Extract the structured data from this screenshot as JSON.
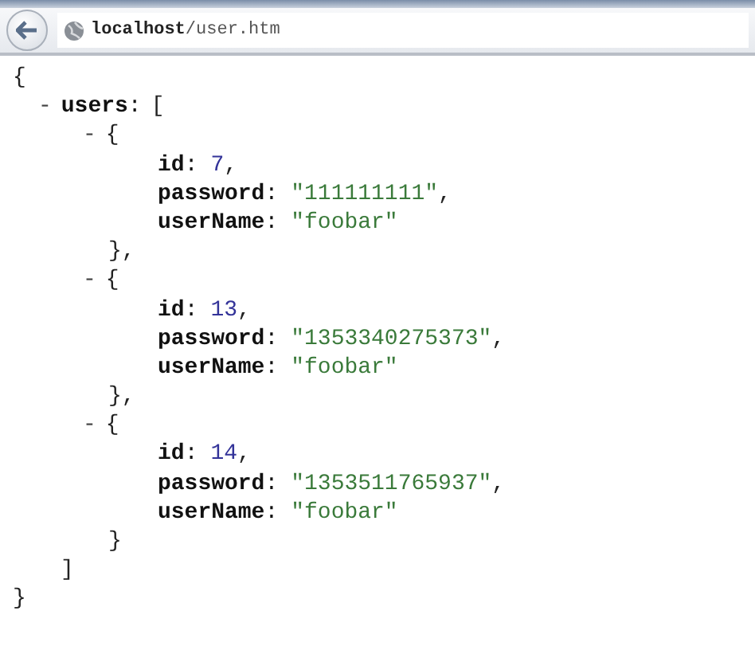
{
  "address_bar": {
    "host": "localhost",
    "path": "/user.htm"
  },
  "document": {
    "open": "{",
    "close": "}",
    "members": [
      {
        "toggle": "-",
        "key": "**users**:",
        "open": "[",
        "close": "]",
        "expanded": true,
        "items": [
          {
            "toggle": "-",
            "open": "{",
            "close": "},",
            "expanded": true,
            "fields": [
              {
                "key": "**id**:",
                "value": "7",
                "kind": "number",
                "trail": ","
              },
              {
                "key": "**password**:",
                "value": "\"111111111\"",
                "kind": "string",
                "trail": ","
              },
              {
                "key": "**userName**:",
                "value": "\"foobar\"",
                "kind": "string"
              }
            ]
          },
          {
            "toggle": "-",
            "open": "{",
            "close": "},",
            "expanded": true,
            "fields": [
              {
                "key": "**id**:",
                "value": "13",
                "kind": "number",
                "trail": ","
              },
              {
                "key": "**password**:",
                "value": "\"1353340275373\"",
                "kind": "string",
                "trail": ","
              },
              {
                "key": "**userName**:",
                "value": "\"foobar\"",
                "kind": "string"
              }
            ]
          },
          {
            "toggle": "-",
            "open": "{",
            "close": "}",
            "expanded": true,
            "fields": [
              {
                "key": "**id**:",
                "value": "14",
                "kind": "number",
                "trail": ","
              },
              {
                "key": "**password**:",
                "value": "\"1353511765937\"",
                "kind": "string",
                "trail": ","
              },
              {
                "key": "**userName**:",
                "value": "\"foobar\"",
                "kind": "string"
              }
            ]
          }
        ]
      }
    ]
  }
}
